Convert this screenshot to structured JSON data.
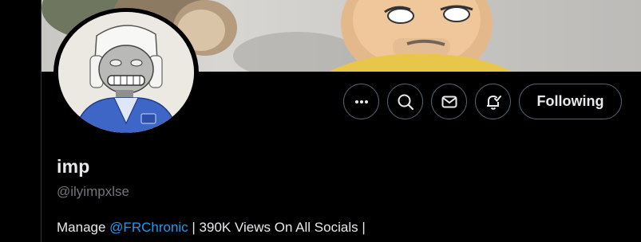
{
  "profile": {
    "display_name": "imp",
    "handle": "@ilyimpxlse",
    "bio_prefix": "Manage ",
    "bio_mention": "@FRChronic",
    "bio_suffix": " | 390K Views On All Socials |"
  },
  "actions": {
    "more_icon": "more-horizontal-icon",
    "search_icon": "search-icon",
    "message_icon": "envelope-icon",
    "notify_icon": "bell-check-icon",
    "follow_label": "Following"
  },
  "colors": {
    "background": "#000000",
    "text_primary": "#e7e9ea",
    "text_secondary": "#71767b",
    "link": "#1d9bf0",
    "border": "#536471"
  }
}
